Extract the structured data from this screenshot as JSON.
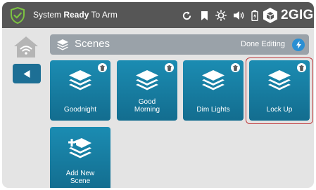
{
  "status_bar": {
    "text_prefix": "System ",
    "text_bold": "Ready",
    "text_suffix": " To Arm",
    "icons": [
      "refresh-icon",
      "bookmark-icon",
      "brightness-icon",
      "volume-icon",
      "battery-icon"
    ],
    "brand": "2GIG"
  },
  "header": {
    "title": "Scenes",
    "done_label": "Done Editing"
  },
  "scenes": [
    {
      "label": "Goodnight"
    },
    {
      "label": "Good\nMorning"
    },
    {
      "label": "Dim Lights"
    },
    {
      "label": "Lock Up"
    },
    {
      "label": "Add New\nScene"
    }
  ],
  "colors": {
    "status_bar": "#565656",
    "tile": "#1a7ea3",
    "header": "#9aa2a9",
    "selected_outline": "#c0393b",
    "done_button": "#2b8fd3"
  }
}
